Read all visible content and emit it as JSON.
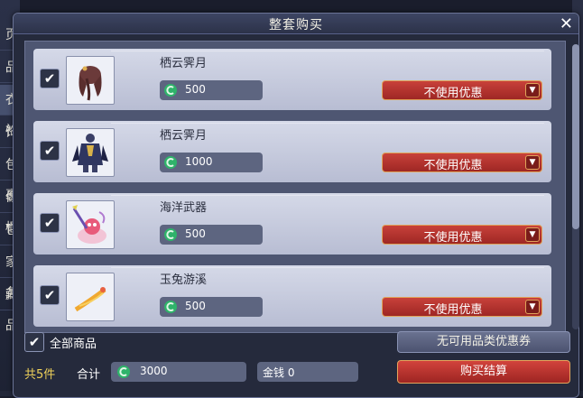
{
  "background": {
    "left_tabs": [
      "页",
      "品",
      "衣衫",
      "饰",
      "包裹",
      "像框",
      "它",
      "家务",
      "藏品"
    ]
  },
  "dialog": {
    "title": "整套购买",
    "close_symbol": "✕"
  },
  "items": [
    {
      "name": "栖云霁月",
      "price": "500",
      "discount": "不使用优惠",
      "checked": true,
      "thumb_icon": "hair-icon"
    },
    {
      "name": "栖云霁月",
      "price": "1000",
      "discount": "不使用优惠",
      "checked": true,
      "thumb_icon": "costume-icon"
    },
    {
      "name": "海洋武器",
      "price": "500",
      "discount": "不使用优惠",
      "checked": true,
      "thumb_icon": "ocean-weapon-icon"
    },
    {
      "name": "玉兔游溪",
      "price": "500",
      "discount": "不使用优惠",
      "checked": true,
      "thumb_icon": "jade-rabbit-icon"
    }
  ],
  "footer": {
    "select_all_label": "全部商品",
    "coupon_button": "无可用品类优惠券",
    "count_label": "共5件",
    "total_label": "合计",
    "total_value": "3000",
    "gold_label": "金钱 0",
    "buy_button": "购买结算"
  },
  "colors": {
    "accent_red": "#c8413a",
    "coin_green": "#2fb36a",
    "count_yellow": "#f0d25a"
  }
}
